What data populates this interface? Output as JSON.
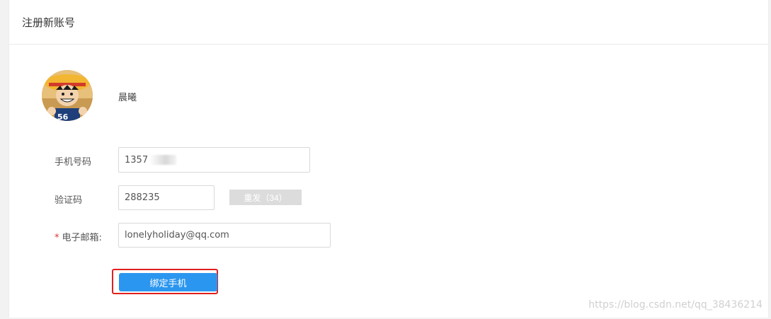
{
  "header": {
    "title": "注册新账号"
  },
  "profile": {
    "username": "晨曦",
    "avatar_icon": "avatar-icon"
  },
  "form": {
    "phone_label": "手机号码",
    "phone_value": "1357",
    "code_label": "验证码",
    "code_value": "288235",
    "resend_label": "重发（34）",
    "email_label": "电子邮箱:",
    "email_required_mark": "*",
    "email_value": "lonelyholiday@qq.com",
    "submit_label": "绑定手机"
  },
  "watermark": "https://blog.csdn.net/qq_38436214",
  "colors": {
    "primary": "#2b96ef",
    "highlight": "#e02020",
    "required": "#e03131"
  }
}
